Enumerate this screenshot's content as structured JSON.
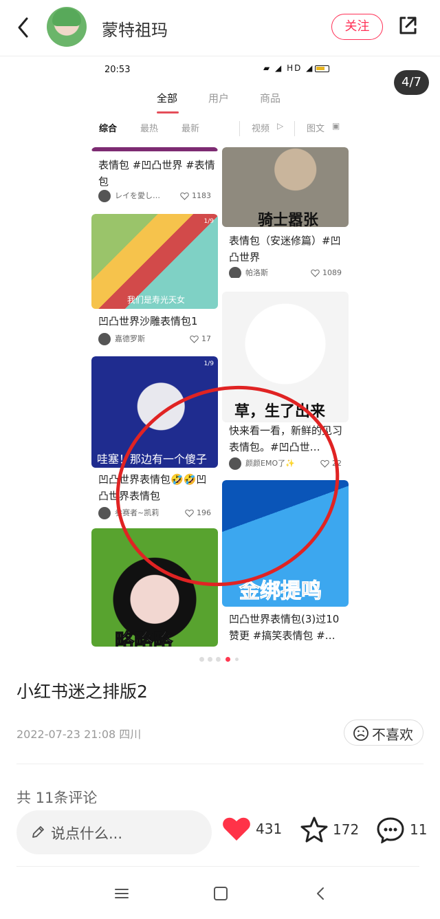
{
  "header": {
    "author": "蒙特祖玛",
    "follow_label": "关注",
    "share_icon": "share-icon",
    "back_icon": "back-icon"
  },
  "image": {
    "counter": "4/7",
    "status": {
      "time": "20:53",
      "right": "HD"
    },
    "tabs": [
      {
        "label": "全部",
        "active": true
      },
      {
        "label": "用户",
        "active": false
      },
      {
        "label": "商品",
        "active": false
      }
    ],
    "filters": [
      {
        "label": "综合",
        "active": true
      },
      {
        "label": "最热",
        "active": false
      },
      {
        "label": "最新",
        "active": false
      },
      {
        "label": "视频",
        "active": false
      },
      {
        "label": "图文",
        "active": false
      }
    ],
    "cards": [
      {
        "title": "表情包 #凹凸世界 #表情包",
        "user": "レイを愛し…",
        "likes": "1183"
      },
      {
        "title": "凹凸世界沙雕表情包1",
        "user": "嘉德罗斯",
        "likes": "17",
        "caption": "我们是寿光天女",
        "tag": "1/9"
      },
      {
        "title": "凹凸世界表情包🤣🤣凹凸世界表情包",
        "user": "参赛者~凯莉",
        "likes": "196",
        "caption": "哇塞！那边有一个傻子",
        "tag": "1/9"
      },
      {
        "title": "",
        "user": "",
        "likes": "",
        "caption": "略略略"
      },
      {
        "title": "表情包（安迷修篇）#凹凸世界",
        "user": "帕洛斯",
        "likes": "1089",
        "caption": "骑士嚣张"
      },
      {
        "title": "快来看一看，新鲜的见习表情包。#凹凸世…",
        "user": "颜颜EMO了✨",
        "likes": "22",
        "caption": "草，生了出来"
      },
      {
        "title": "凹凸世界表情包(3)过10赞更 #搞笑表情包 #…",
        "user": "",
        "likes": "",
        "caption": "金绑提鸣"
      }
    ]
  },
  "post": {
    "title": "小红书迷之排版2",
    "date_location": "2022-07-23 21:08 四川",
    "dislike_label": "不喜欢",
    "comment_count": "共 11条评论"
  },
  "bottom": {
    "comment_placeholder": "说点什么...",
    "likes": "431",
    "favorites": "172",
    "comments": "11"
  },
  "colors": {
    "accent": "#ff2f55",
    "red_annotation": "#e02323"
  }
}
